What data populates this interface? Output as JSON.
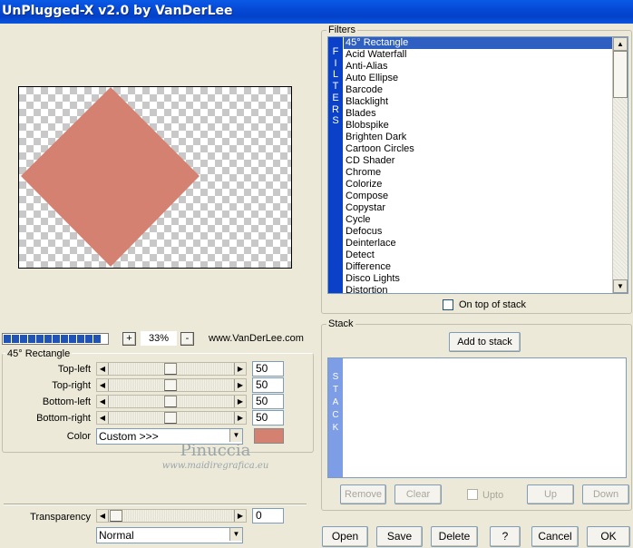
{
  "window": {
    "title": "UnPlugged-X v2.0 by VanDerLee"
  },
  "preview": {
    "shape_color": "#d58172",
    "zoom_value": "33%",
    "zoom_in": "+",
    "zoom_out": "-",
    "website": "www.VanDerLee.com"
  },
  "params": {
    "group_title": "45° Rectangle",
    "sliders": [
      {
        "label": "Top-left",
        "value": "50"
      },
      {
        "label": "Top-right",
        "value": "50"
      },
      {
        "label": "Bottom-left",
        "value": "50"
      },
      {
        "label": "Bottom-right",
        "value": "50"
      }
    ],
    "color_label": "Color",
    "color_select": "Custom >>>",
    "color_swatch": "#d58172",
    "transparency_label": "Transparency",
    "transparency_value": "0",
    "blend_mode": "Normal"
  },
  "watermark": {
    "line1": "Pinuccia",
    "line2": "www.maidiregrafica.eu"
  },
  "filters": {
    "group_title": "Filters",
    "strip_letters": [
      "F",
      "I",
      "L",
      "T",
      "E",
      "R",
      "S"
    ],
    "items": [
      "45° Rectangle",
      "Acid Waterfall",
      "Anti-Alias",
      "Auto Ellipse",
      "Barcode",
      "Blacklight",
      "Blades",
      "Blobspike",
      "Brighten Dark",
      "Cartoon Circles",
      "CD Shader",
      "Chrome",
      "Colorize",
      "Compose",
      "Copystar",
      "Cycle",
      "Defocus",
      "Deinterlace",
      "Detect",
      "Difference",
      "Disco Lights",
      "Distortion"
    ],
    "selected": "45° Rectangle",
    "on_top_label": "On top of stack"
  },
  "stack": {
    "group_title": "Stack",
    "add_label": "Add to stack",
    "strip_letters": [
      "S",
      "T",
      "A",
      "C",
      "K"
    ],
    "remove_label": "Remove",
    "clear_label": "Clear",
    "upto_label": "Upto",
    "up_label": "Up",
    "down_label": "Down"
  },
  "buttons": {
    "open": "Open",
    "save": "Save",
    "delete": "Delete",
    "help": "?",
    "cancel": "Cancel",
    "ok": "OK"
  }
}
